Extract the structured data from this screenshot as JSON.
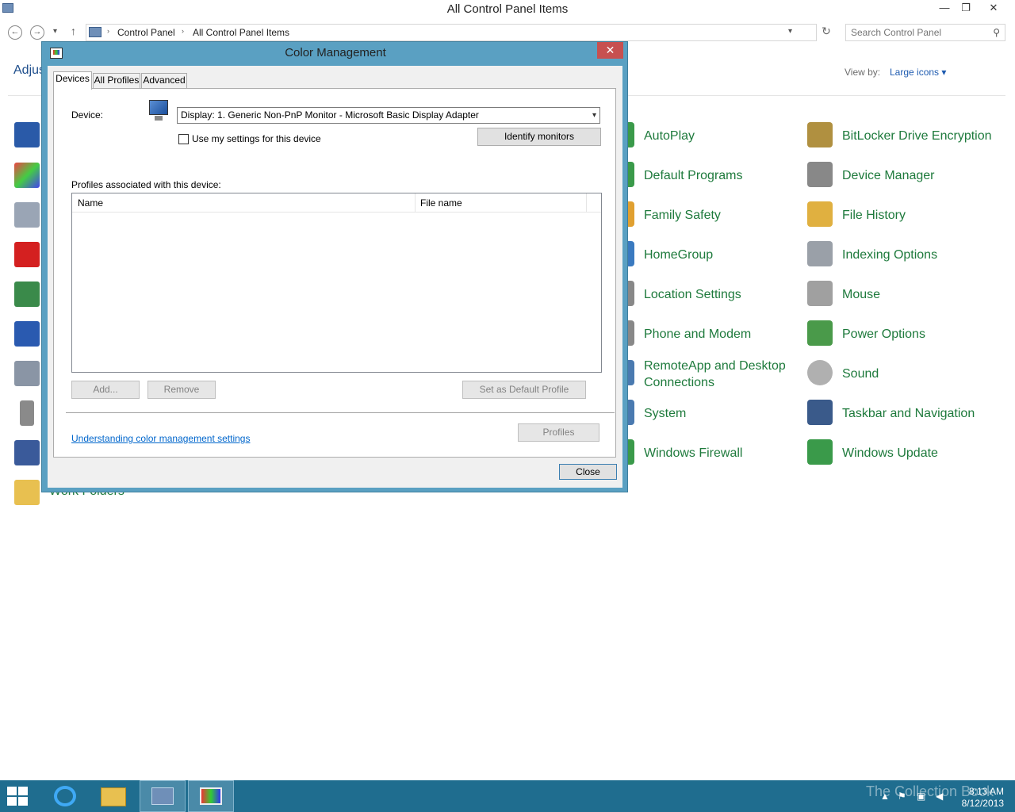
{
  "explorer": {
    "title": "All Control Panel Items",
    "minimize": "—",
    "restore": "❐",
    "close": "✕",
    "back_glyph": "←",
    "forward_glyph": "→",
    "recent_glyph": "▾",
    "up_glyph": "↑",
    "breadcrumb": [
      "Control Panel",
      "All Control Panel Items"
    ],
    "crumb_sep": "›",
    "address_dropdown": "▾",
    "refresh_glyph": "↻",
    "search_placeholder": "Search Control Panel",
    "search_glyph": "⚲",
    "heading": "Adjus",
    "view_by_label": "View by:",
    "view_by_value": "Large icons ▾",
    "work_folders": "Work Folders"
  },
  "items_col2": [
    {
      "label": "AutoPlay",
      "icon": "autoplay-icon",
      "color": "#3a9a4a"
    },
    {
      "label": "Default Programs",
      "icon": "default-programs-icon",
      "color": "#3a9a4a"
    },
    {
      "label": "Family Safety",
      "icon": "family-safety-icon",
      "color": "#e0a030"
    },
    {
      "label": "HomeGroup",
      "icon": "homegroup-icon",
      "color": "#3a7ac0"
    },
    {
      "label": "Location Settings",
      "icon": "location-icon",
      "color": "#888888"
    },
    {
      "label": "Phone and Modem",
      "icon": "phone-icon",
      "color": "#888888"
    },
    {
      "label": "RemoteApp and Desktop Connections",
      "icon": "remoteapp-icon",
      "color": "#4a7ab0"
    },
    {
      "label": "System",
      "icon": "system-icon",
      "color": "#4a7ab0"
    },
    {
      "label": "Windows Firewall",
      "icon": "firewall-icon",
      "color": "#3a9a4a"
    }
  ],
  "items_col3": [
    {
      "label": "BitLocker Drive Encryption",
      "icon": "bitlocker-icon",
      "color": "#b09040"
    },
    {
      "label": "Device Manager",
      "icon": "device-manager-icon",
      "color": "#888888"
    },
    {
      "label": "File History",
      "icon": "file-history-icon",
      "color": "#e0b040"
    },
    {
      "label": "Indexing Options",
      "icon": "indexing-icon",
      "color": "#9aa0a8"
    },
    {
      "label": "Mouse",
      "icon": "mouse-icon",
      "color": "#a0a0a0"
    },
    {
      "label": "Power Options",
      "icon": "power-icon",
      "color": "#4a9a4a"
    },
    {
      "label": "Sound",
      "icon": "sound-icon",
      "color": "#b0b0b0"
    },
    {
      "label": "Taskbar and Navigation",
      "icon": "taskbar-icon",
      "color": "#3a5a8a"
    },
    {
      "label": "Windows Update",
      "icon": "windows-update-icon",
      "color": "#3a9a4a"
    }
  ],
  "dialog": {
    "title": "Color Management",
    "close": "✕",
    "tabs": [
      "Devices",
      "All Profiles",
      "Advanced"
    ],
    "device_label": "Device:",
    "device_value": "Display: 1. Generic Non-PnP Monitor - Microsoft Basic Display Adapter",
    "device_caret": "▾",
    "use_settings_label": "Use my settings for this device",
    "identify_button": "Identify monitors",
    "profiles_label": "Profiles associated with this device:",
    "columns": [
      "Name",
      "File name"
    ],
    "add_button": "Add...",
    "remove_button": "Remove",
    "set_default_button": "Set as Default Profile",
    "profiles_button": "Profiles",
    "help_link": "Understanding color management settings",
    "close_button": "Close"
  },
  "taskbar": {
    "time": "8:13 AM",
    "date": "8/12/2013",
    "watermark": "The Collection Book",
    "tray_up": "▲",
    "tray_flag": "⚑",
    "tray_net": "▣",
    "tray_vol": "◀"
  }
}
